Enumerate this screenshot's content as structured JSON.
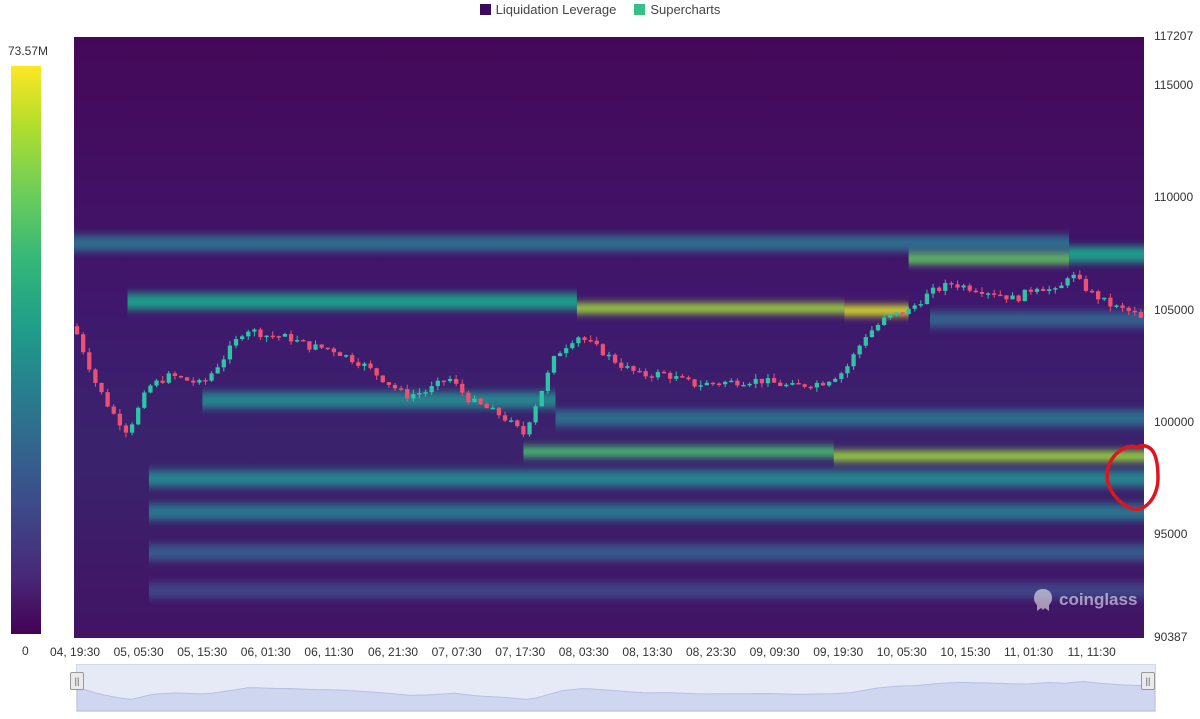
{
  "legend": [
    {
      "label": "Liquidation Leverage",
      "color": "#3b0a5a"
    },
    {
      "label": "Supercharts",
      "color": "#35c08a"
    }
  ],
  "colorbar": {
    "max_label": "73.57M",
    "min_label": "0"
  },
  "watermark": "coinglass",
  "chart_data": {
    "type": "heatmap",
    "title": "",
    "xlabel": "",
    "ylabel": "",
    "ylim": [
      90387,
      117207
    ],
    "yticks": [
      "117207",
      "115000",
      "110000",
      "105000",
      "100000",
      "95000",
      "90387"
    ],
    "xticks": [
      "04, 19:30",
      "05, 05:30",
      "05, 15:30",
      "06, 01:30",
      "06, 11:30",
      "06, 21:30",
      "07, 07:30",
      "07, 17:30",
      "08, 03:30",
      "08, 13:30",
      "08, 23:30",
      "09, 09:30",
      "09, 19:30",
      "10, 05:30",
      "10, 15:30",
      "11, 01:30",
      "11, 11:30"
    ],
    "colorbar_range": [
      0,
      73.57
    ],
    "colorbar_unit": "M",
    "colorscale": [
      "#440154",
      "#482878",
      "#3e4989",
      "#31688e",
      "#26828e",
      "#1f9e89",
      "#35b779",
      "#6ece58",
      "#b5de2b",
      "#fde725"
    ],
    "liquidation_bands": [
      {
        "price": 108000,
        "start": 0.0,
        "end": 0.93,
        "intensity": 0.35
      },
      {
        "price": 107300,
        "start": 0.78,
        "end": 0.93,
        "intensity": 0.75
      },
      {
        "price": 107500,
        "start": 0.93,
        "end": 1.0,
        "intensity": 0.55
      },
      {
        "price": 105400,
        "start": 0.05,
        "end": 0.47,
        "intensity": 0.55
      },
      {
        "price": 105100,
        "start": 0.47,
        "end": 0.72,
        "intensity": 0.85
      },
      {
        "price": 105000,
        "start": 0.72,
        "end": 0.78,
        "intensity": 0.95
      },
      {
        "price": 104600,
        "start": 0.8,
        "end": 1.0,
        "intensity": 0.3
      },
      {
        "price": 101000,
        "start": 0.12,
        "end": 0.45,
        "intensity": 0.45
      },
      {
        "price": 100200,
        "start": 0.45,
        "end": 1.0,
        "intensity": 0.35
      },
      {
        "price": 98700,
        "start": 0.42,
        "end": 0.71,
        "intensity": 0.7
      },
      {
        "price": 98500,
        "start": 0.71,
        "end": 1.0,
        "intensity": 0.85
      },
      {
        "price": 97500,
        "start": 0.07,
        "end": 1.0,
        "intensity": 0.45
      },
      {
        "price": 96000,
        "start": 0.07,
        "end": 1.0,
        "intensity": 0.38
      },
      {
        "price": 94200,
        "start": 0.07,
        "end": 1.0,
        "intensity": 0.28
      },
      {
        "price": 92500,
        "start": 0.07,
        "end": 1.0,
        "intensity": 0.2
      }
    ],
    "price_series": {
      "name": "",
      "x": [
        0.0,
        0.02,
        0.035,
        0.05,
        0.07,
        0.09,
        0.12,
        0.14,
        0.16,
        0.18,
        0.2,
        0.22,
        0.24,
        0.27,
        0.29,
        0.31,
        0.33,
        0.35,
        0.37,
        0.4,
        0.42,
        0.44,
        0.45,
        0.47,
        0.49,
        0.51,
        0.53,
        0.55,
        0.58,
        0.61,
        0.64,
        0.67,
        0.7,
        0.72,
        0.74,
        0.76,
        0.78,
        0.8,
        0.82,
        0.84,
        0.86,
        0.88,
        0.9,
        0.92,
        0.93,
        0.95,
        0.97,
        0.99,
        1.0
      ],
      "y": [
        104300,
        101800,
        100500,
        99600,
        101600,
        102100,
        101700,
        102900,
        104200,
        103900,
        103800,
        103400,
        103300,
        102600,
        101900,
        101200,
        101400,
        102000,
        101000,
        100300,
        99500,
        101800,
        103000,
        103900,
        103300,
        102600,
        102100,
        102200,
        101700,
        101800,
        101900,
        101600,
        101800,
        102300,
        103900,
        104700,
        105000,
        105800,
        106200,
        106000,
        105800,
        105500,
        106100,
        105800,
        106700,
        105800,
        105200,
        104900,
        104500
      ]
    }
  }
}
